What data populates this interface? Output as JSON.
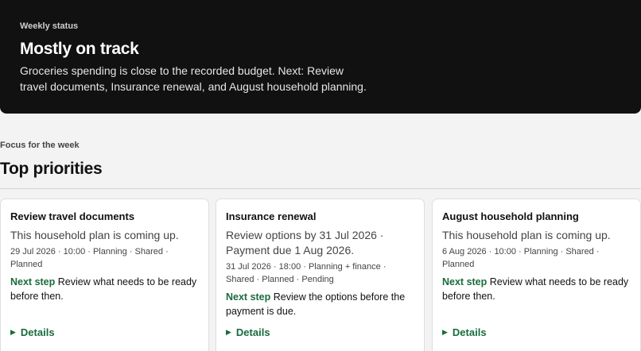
{
  "hero": {
    "eyebrow": "Weekly status",
    "title": "Mostly on track",
    "summary": "Groceries spending is close to the recorded budget. Next: Review travel documents, Insurance renewal, and August household planning."
  },
  "section": {
    "eyebrow": "Focus for the week",
    "title": "Top priorities"
  },
  "cards": [
    {
      "title": "Review travel documents",
      "description": "This household plan is coming up.",
      "meta": "29 Jul 2026 · 10:00 · Planning · Shared · Planned",
      "next_label": "Next step",
      "next_text": "Review what needs to be ready before then.",
      "details_label": "Details"
    },
    {
      "title": "Insurance renewal",
      "description": "Review options by 31 Jul 2026 · Payment due 1 Aug 2026.",
      "meta": "31 Jul 2026 · 18:00 · Planning + finance · Shared · Planned · Pending",
      "next_label": "Next step",
      "next_text": "Review the options before the payment is due.",
      "details_label": "Details"
    },
    {
      "title": "August household planning",
      "description": "This household plan is coming up.",
      "meta": "6 Aug 2026 · 10:00 · Planning · Shared · Planned",
      "next_label": "Next step",
      "next_text": "Review what needs to be ready before then.",
      "details_label": "Details"
    }
  ],
  "colors": {
    "hero_bg": "#111111",
    "accent": "#1a6b3c",
    "page_bg": "#f3f3f3"
  },
  "icons": {
    "details": "triangle-right-icon"
  }
}
